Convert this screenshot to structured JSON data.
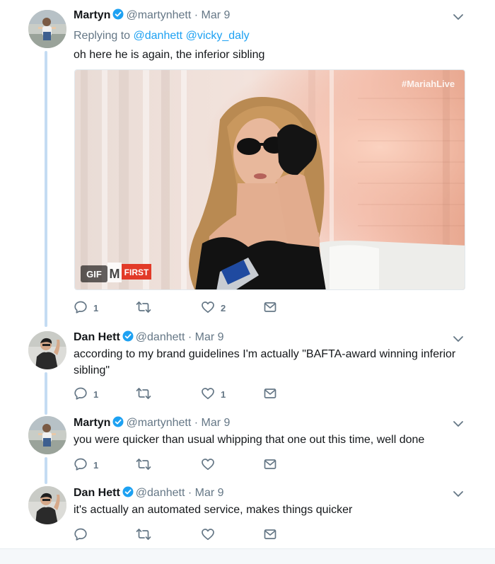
{
  "tweets": [
    {
      "name": "Martyn",
      "handle": "@martynhett",
      "date": "Mar 9",
      "replying_prefix": "Replying to",
      "replying_to": [
        "@danhett",
        "@vicky_daly"
      ],
      "text": "oh here he is again, the inferior sibling",
      "media": {
        "watermark": "#MariahLive",
        "gif_badge": "GIF",
        "channel_badge": "FIRST"
      },
      "counts": {
        "reply": "1",
        "retweet": "",
        "like": "2"
      }
    },
    {
      "name": "Dan Hett",
      "handle": "@danhett",
      "date": "Mar 9",
      "text_line1": "according to my brand guidelines I'm actually \"BAFTA-award winning inferior",
      "text_line2": "sibling\"",
      "counts": {
        "reply": "1",
        "retweet": "",
        "like": "1"
      }
    },
    {
      "name": "Martyn",
      "handle": "@martynhett",
      "date": "Mar 9",
      "text": "you were quicker than usual whipping that one out this time, well done",
      "counts": {
        "reply": "1",
        "retweet": "",
        "like": ""
      }
    },
    {
      "name": "Dan Hett",
      "handle": "@danhett",
      "date": "Mar 9",
      "text": "it's actually an automated service, makes things quicker",
      "counts": {
        "reply": "",
        "retweet": "",
        "like": ""
      }
    }
  ],
  "separator": "·",
  "colors": {
    "accent": "#1da1f2",
    "muted": "#657786",
    "thread": "#c4dcf3"
  },
  "icons": [
    "verified-badge-icon",
    "chevron-down-icon",
    "reply-icon",
    "retweet-icon",
    "like-icon",
    "direct-message-icon"
  ]
}
